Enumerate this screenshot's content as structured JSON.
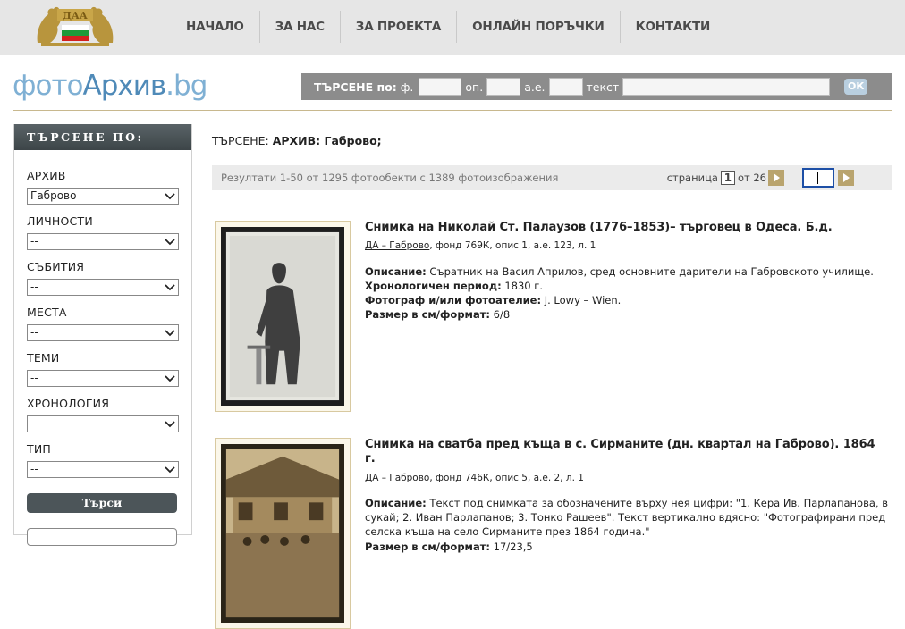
{
  "nav": [
    "НАЧАЛО",
    "ЗА НАС",
    "ЗА ПРОЕКТА",
    "ОНЛАЙН ПОРЪЧКИ",
    "КОНТАКТИ"
  ],
  "brand": {
    "part1": "фото",
    "part2": "Архив",
    "part3": ".bg"
  },
  "search": {
    "label": "ТЪРСЕНЕ по:",
    "f_label": "ф.",
    "op_label": "оп.",
    "ae_label": "а.е.",
    "text_label": "текст",
    "ok": "ОК"
  },
  "sidebar": {
    "header": "ТЪРСЕНЕ ПО:",
    "filters": [
      {
        "label": "АРХИВ",
        "value": "Габрово"
      },
      {
        "label": "ЛИЧНОСТИ",
        "value": "--"
      },
      {
        "label": "СЪБИТИЯ",
        "value": "--"
      },
      {
        "label": "МЕСТА",
        "value": "--"
      },
      {
        "label": "ТЕМИ",
        "value": "--"
      },
      {
        "label": "ХРОНОЛОГИЯ",
        "value": "--"
      },
      {
        "label": "ТИП",
        "value": "--"
      }
    ],
    "button": "Търси"
  },
  "query": {
    "prefix": "ТЪРСЕНЕ:",
    "value": "АРХИВ: Габрово;"
  },
  "results": {
    "text": "Резултати 1-50 от 1295 фотообекти с 1389 фотоизображения",
    "page_label": "страница",
    "page": "1",
    "of_label": "от 26"
  },
  "items": [
    {
      "title": "Снимка на Николай Ст. Палаузов (1776–1853)– търговец в Одеса. Б.д.",
      "source_link": "ДА – Габрово",
      "source_rest": ", фонд 769К, опис 1, а.е. 123, л. 1",
      "desc_label": "Описание:",
      "desc": " Съратник на Васил Априлов, сред основните дарители на Габровското училище.",
      "period_label": "Хронологичен период:",
      "period": " 1830 г.",
      "photographer_label": "Фотограф и/или фотоателие:",
      "photographer": " J. Lowy – Wien.",
      "size_label": "Размер в см/формат:",
      "size": " 6/8"
    },
    {
      "title": "Снимка на сватба пред къща в с. Сирманите (дн. квартал на Габрово). 1864 г.",
      "source_link": "ДА – Габрово",
      "source_rest": ", фонд 746К, опис 5, а.е. 2, л. 1",
      "desc_label": "Описание:",
      "desc": " Текст под снимката за обозначените върху нея цифри: \"1. Кера Ив. Парлапанова, в сукай; 2. Иван Парлапанов; 3. Тонко Рашеев\". Текст вертикално вдясно: \"Фотографирани пред селска къща на село Сирманите през 1864 година.\"",
      "size_label": "Размер в см/формат:",
      "size": " 17/23,5"
    }
  ]
}
